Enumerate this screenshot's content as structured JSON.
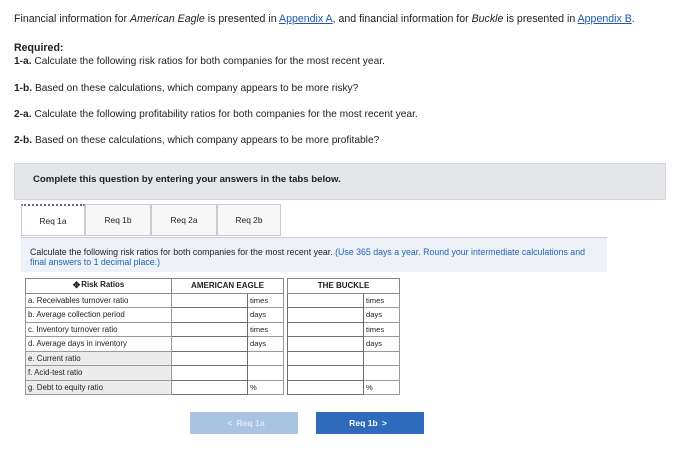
{
  "intro": {
    "part1": "Financial information for ",
    "company1": "American Eagle",
    "part2": " is presented in ",
    "link1": "Appendix A",
    "part3": ", and financial information for ",
    "company2": "Buckle",
    "part4": " is presented in ",
    "link2": "Appendix B",
    "part5": "."
  },
  "required": {
    "title": "Required:",
    "items": [
      {
        "num": "1-a.",
        "text": " Calculate the following risk ratios for both companies for the most recent year."
      },
      {
        "num": "1-b.",
        "text": " Based on these calculations, which company appears to be more risky?"
      },
      {
        "num": "2-a.",
        "text": " Calculate the following profitability ratios for both companies for the most recent year."
      },
      {
        "num": "2-b.",
        "text": " Based on these calculations, which company appears to be more profitable?"
      }
    ]
  },
  "instruction": "Complete this question by entering your answers in the tabs below.",
  "tabs": [
    "Req 1a",
    "Req 1b",
    "Req 2a",
    "Req 2b"
  ],
  "panel": {
    "text": "Calculate the following risk ratios for both companies for the most recent year. ",
    "note": "(Use 365 days a year. Round your intermediate calculations and final answers to 1 decimal place.)"
  },
  "table": {
    "header_label": "Risk Ratios",
    "company1": "AMERICAN EAGLE",
    "company2": "THE BUCKLE",
    "rows": [
      {
        "label": "a. Receivables turnover ratio",
        "unit1": "times",
        "unit2": "times",
        "value1": "",
        "value2": ""
      },
      {
        "label": "b. Average collection period",
        "unit1": "days",
        "unit2": "days",
        "value1": "",
        "value2": ""
      },
      {
        "label": "c. Inventory turnover ratio",
        "unit1": "times",
        "unit2": "times",
        "value1": "",
        "value2": ""
      },
      {
        "label": "d. Average days in inventory",
        "unit1": "days",
        "unit2": "days",
        "value1": "",
        "value2": ""
      },
      {
        "label": "e. Current ratio",
        "unit1": "",
        "unit2": "",
        "value1": "",
        "value2": ""
      },
      {
        "label": "f. Acid-test ratio",
        "unit1": "",
        "unit2": "",
        "value1": "",
        "value2": ""
      },
      {
        "label": "g. Debt to equity ratio",
        "unit1": "%",
        "unit2": "%",
        "value1": "",
        "value2": ""
      }
    ]
  },
  "nav": {
    "prev_label": "Req 1a",
    "next_label": "Req 1b",
    "prev_chevron": "<",
    "next_chevron": ">"
  },
  "colors": {
    "link": "#1e5aa8",
    "note": "#1f62b5",
    "next_button": "#2f6bbd",
    "prev_button_disabled": "#a9c3e3"
  }
}
